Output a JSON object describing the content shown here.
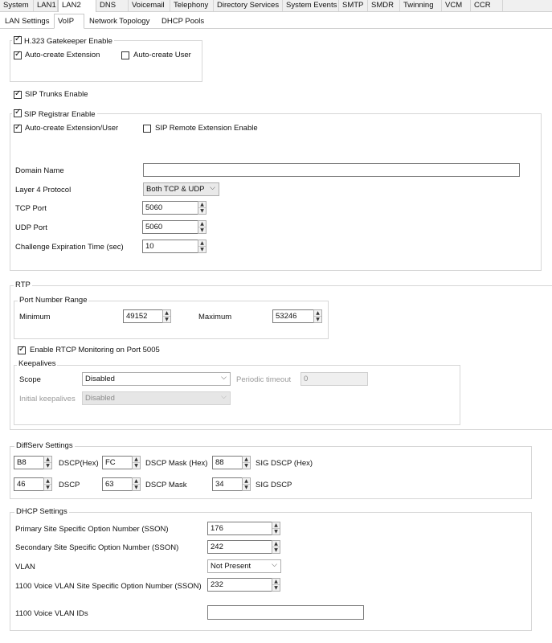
{
  "main_tabs": [
    "System",
    "LAN1",
    "LAN2",
    "DNS",
    "Voicemail",
    "Telephony",
    "Directory Services",
    "System Events",
    "SMTP",
    "SMDR",
    "Twinning",
    "VCM",
    "CCR"
  ],
  "sub_tabs": [
    "LAN Settings",
    "VoIP",
    "Network Topology",
    "DHCP Pools"
  ],
  "h323": {
    "gatekeeper_enable": "H.323 Gatekeeper Enable",
    "auto_create_extension": "Auto-create Extension",
    "auto_create_user": "Auto-create User"
  },
  "sip_trunks_enable": "SIP Trunks Enable",
  "sip_registrar": {
    "enable": "SIP Registrar Enable",
    "auto_create": "Auto-create Extension/User",
    "remote_extension": "SIP Remote Extension Enable",
    "domain_name_label": "Domain Name",
    "domain_name_value": "",
    "layer4_label": "Layer 4 Protocol",
    "layer4_value": "Both TCP & UDP",
    "tcp_port_label": "TCP Port",
    "tcp_port_value": "5060",
    "udp_port_label": "UDP Port",
    "udp_port_value": "5060",
    "challenge_label": "Challenge Expiration Time (sec)",
    "challenge_value": "10"
  },
  "rtp": {
    "title": "RTP",
    "port_range_title": "Port Number Range",
    "minimum_label": "Minimum",
    "minimum_value": "49152",
    "maximum_label": "Maximum",
    "maximum_value": "53246",
    "rtcp_label": "Enable RTCP Monitoring on Port 5005",
    "keepalives_title": "Keepalives",
    "scope_label": "Scope",
    "scope_value": "Disabled",
    "periodic_label": "Periodic timeout",
    "periodic_value": "0",
    "initial_label": "Initial keepalives",
    "initial_value": "Disabled"
  },
  "diffserv": {
    "title": "DiffServ Settings",
    "dscp_hex_value": "B8",
    "dscp_hex_label": "DSCP(Hex)",
    "mask_hex_value": "FC",
    "mask_hex_label": "DSCP Mask (Hex)",
    "sig_hex_value": "88",
    "sig_hex_label": "SIG DSCP (Hex)",
    "dscp_value": "46",
    "dscp_label": "DSCP",
    "mask_value": "63",
    "mask_label": "DSCP Mask",
    "sig_value": "34",
    "sig_label": "SIG DSCP"
  },
  "dhcp": {
    "title": "DHCP Settings",
    "primary_label": "Primary Site Specific Option Number (SSON)",
    "primary_value": "176",
    "secondary_label": "Secondary Site Specific Option Number (SSON)",
    "secondary_value": "242",
    "vlan_label": "VLAN",
    "vlan_value": "Not Present",
    "voice_vlan_label": "1100 Voice VLAN Site Specific Option Number (SSON)",
    "voice_vlan_value": "232",
    "voice_vlan_ids_label": "1100 Voice VLAN IDs",
    "voice_vlan_ids_value": ""
  }
}
